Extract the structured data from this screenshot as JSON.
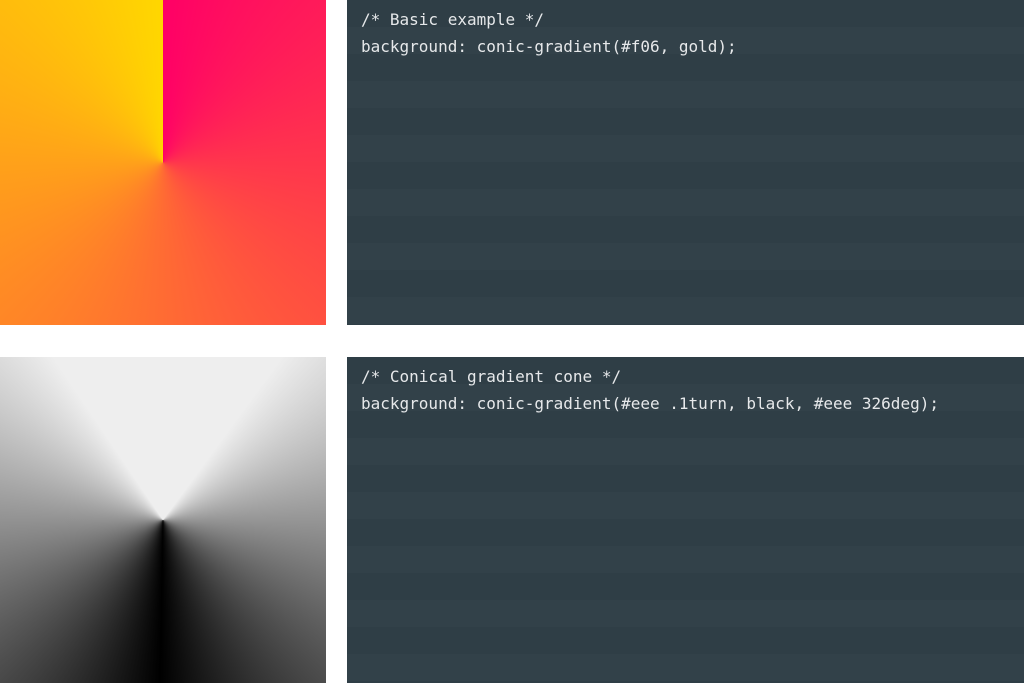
{
  "examples": [
    {
      "comment": "/* Basic example */",
      "code": "background: conic-gradient(#f06, gold);",
      "gradient_css": "conic-gradient(#f06, gold)"
    },
    {
      "comment": "/* Conical gradient cone */",
      "code": "background: conic-gradient(#eee .1turn, black, #eee 326deg);",
      "gradient_css": "conic-gradient(#eee .1turn, black, #eee 326deg)"
    }
  ],
  "colors": {
    "code_bg_a": "#2f3e46",
    "code_bg_b": "#324149",
    "code_text": "#e6e8ea"
  }
}
